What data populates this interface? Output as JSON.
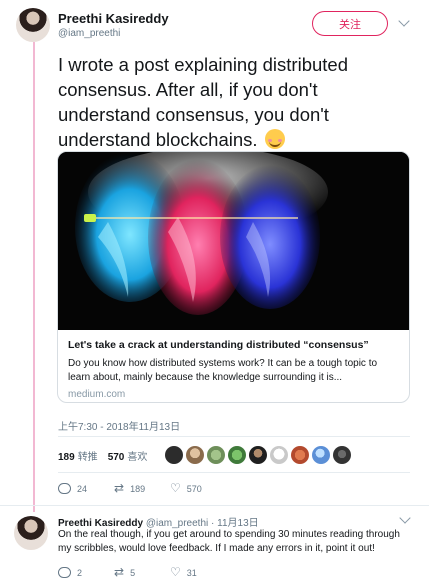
{
  "tweet": {
    "author_name": "Preethi Kasireddy",
    "author_handle": "@iam_preethi",
    "follow_label": "关注",
    "text": "I wrote a post explaining distributed consensus. After all, if you don't understand consensus, you don't understand blockchains.",
    "timestamp": "上午7:30 - 2018年11月13日",
    "retweets_count": "189",
    "retweets_label": "转推",
    "likes_count": "570",
    "likes_label": "喜欢",
    "actions": {
      "replies": "24",
      "retweets": "189",
      "likes": "570"
    }
  },
  "card": {
    "title": "Let's take a crack at understanding distributed “consensus”",
    "description": "Do you know how distributed systems work?   It can be a tough topic to learn about, mainly because the knowledge surrounding it is...",
    "domain": "medium.com"
  },
  "likers": [
    {
      "icon": "avatar-1",
      "color": "#2c2c2c"
    },
    {
      "icon": "avatar-2",
      "color": "#8a6b4c"
    },
    {
      "icon": "avatar-3",
      "color": "#6e8f5a"
    },
    {
      "icon": "avatar-4",
      "color": "#3f7a3a"
    },
    {
      "icon": "avatar-5",
      "color": "#1f1f1f"
    },
    {
      "icon": "avatar-6",
      "color": "#c9c9c9"
    },
    {
      "icon": "avatar-7",
      "color": "#b34a2e"
    },
    {
      "icon": "avatar-8",
      "color": "#5b8fd6"
    },
    {
      "icon": "avatar-9",
      "color": "#333333"
    }
  ],
  "reply": {
    "author_name": "Preethi Kasireddy",
    "author_handle": "@iam_preethi",
    "date": "· 11月13日",
    "text": "On the real though, if you get around to spending 30 minutes reading through my scribbles, would love feedback. If I made any errors in it, point it out!",
    "actions": {
      "replies": "2",
      "retweets": "5",
      "likes": "31"
    }
  },
  "colors": {
    "accent": "#e0245e",
    "thread_line": "#f2b8d2",
    "muted": "#657786"
  }
}
